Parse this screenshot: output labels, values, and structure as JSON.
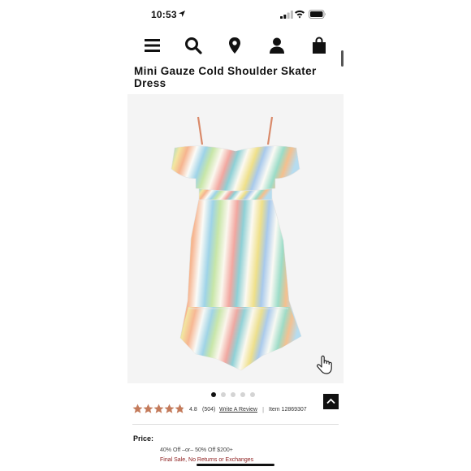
{
  "status_bar": {
    "time": "10:53"
  },
  "nav": {
    "icons": [
      "menu-icon",
      "search-icon",
      "location-pin-icon",
      "account-icon",
      "shopping-bag-icon"
    ]
  },
  "product": {
    "title": "Mini Gauze Cold Shoulder Skater Dress",
    "carousel": {
      "total": 5,
      "active_index": 0
    },
    "rating": {
      "value": "4.8",
      "stars_fraction": 0.96,
      "review_count": "(504)",
      "write_review_label": "Write A Review",
      "separator": "|",
      "item_number": "Item 12869307"
    },
    "price": {
      "label": "Price:",
      "promo": "40% Off –or– 50% Off $200+",
      "final_sale": "Final Sale, No Returns or Exchanges"
    }
  },
  "colors": {
    "star": "#c47a5a",
    "final_sale": "#8b1a1a",
    "image_bg": "#f4f4f4"
  }
}
